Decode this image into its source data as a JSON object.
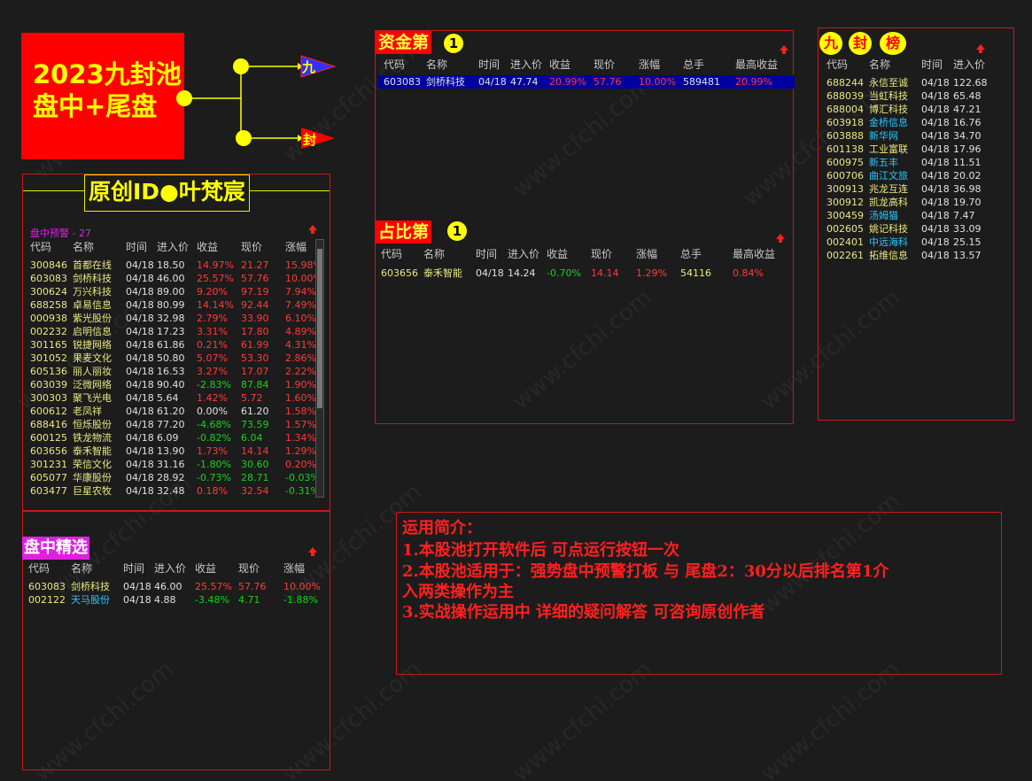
{
  "logo": {
    "line1": "2023九封池",
    "line2": "盘中+尾盘"
  },
  "flow": {
    "node_top": "九",
    "node_bottom": "封"
  },
  "author": {
    "label": "原创ID●叶梵宸"
  },
  "warning": {
    "title": "盘中预警 - 27",
    "headers": [
      "代码",
      "名称",
      "时间",
      "进入价",
      "收益",
      "现价",
      "涨幅"
    ],
    "rows": [
      [
        "300846",
        "首都在线",
        "04/18",
        "18.50",
        "14.97%",
        "21.27",
        "15.98%"
      ],
      [
        "603083",
        "剑桥科技",
        "04/18",
        "46.00",
        "25.57%",
        "57.76",
        "10.00%"
      ],
      [
        "300624",
        "万兴科技",
        "04/18",
        "89.00",
        "9.20%",
        "97.19",
        "7.94%"
      ],
      [
        "688258",
        "卓易信息",
        "04/18",
        "80.99",
        "14.14%",
        "92.44",
        "7.49%"
      ],
      [
        "000938",
        "紫光股份",
        "04/18",
        "32.98",
        "2.79%",
        "33.90",
        "6.10%"
      ],
      [
        "002232",
        "启明信息",
        "04/18",
        "17.23",
        "3.31%",
        "17.80",
        "4.89%"
      ],
      [
        "301165",
        "锐捷网络",
        "04/18",
        "61.86",
        "0.21%",
        "61.99",
        "4.31%"
      ],
      [
        "301052",
        "果麦文化",
        "04/18",
        "50.80",
        "5.07%",
        "53.30",
        "2.86%"
      ],
      [
        "605136",
        "丽人丽妆",
        "04/18",
        "16.53",
        "3.27%",
        "17.07",
        "2.22%"
      ],
      [
        "603039",
        "泛微网络",
        "04/18",
        "90.40",
        "-2.83%",
        "87.84",
        "1.90%"
      ],
      [
        "300303",
        "聚飞光电",
        "04/18",
        "5.64",
        "1.42%",
        "5.72",
        "1.60%"
      ],
      [
        "600612",
        "老凤祥",
        "04/18",
        "61.20",
        "0.00%",
        "61.20",
        "1.58%"
      ],
      [
        "688416",
        "恒烁股份",
        "04/18",
        "77.20",
        "-4.68%",
        "73.59",
        "1.57%"
      ],
      [
        "600125",
        "铁龙物流",
        "04/18",
        "6.09",
        "-0.82%",
        "6.04",
        "1.34%"
      ],
      [
        "603656",
        "泰禾智能",
        "04/18",
        "13.90",
        "1.73%",
        "14.14",
        "1.29%"
      ],
      [
        "301231",
        "荣信文化",
        "04/18",
        "31.16",
        "-1.80%",
        "30.60",
        "0.20%"
      ],
      [
        "605077",
        "华康股份",
        "04/18",
        "28.92",
        "-0.73%",
        "28.71",
        "-0.03%"
      ],
      [
        "603477",
        "巨星农牧",
        "04/18",
        "32.48",
        "0.18%",
        "32.54",
        "-0.31%"
      ]
    ]
  },
  "intraday": {
    "title": "盘中精选",
    "headers": [
      "代码",
      "名称",
      "时间",
      "进入价",
      "收益",
      "现价",
      "涨幅"
    ],
    "rows": [
      [
        "603083",
        "剑桥科技",
        "04/18",
        "46.00",
        "25.57%",
        "57.76",
        "10.00%"
      ],
      [
        "002122",
        "天马股份",
        "04/18",
        "4.88",
        "-3.48%",
        "4.71",
        "-1.88%"
      ]
    ]
  },
  "fund": {
    "title": "资金第",
    "badge": "1",
    "headers": [
      "代码",
      "名称",
      "时间",
      "进入价",
      "收益",
      "现价",
      "涨幅",
      "总手",
      "最高收益"
    ],
    "rows": [
      [
        "603083",
        "剑桥科技",
        "04/18",
        "47.74",
        "20.99%",
        "57.76",
        "10.00%",
        "589481",
        "20.99%"
      ]
    ]
  },
  "ratio": {
    "title": "占比第",
    "badge": "1",
    "headers": [
      "代码",
      "名称",
      "时间",
      "进入价",
      "收益",
      "现价",
      "涨幅",
      "总手",
      "最高收益"
    ],
    "rows": [
      [
        "603656",
        "泰禾智能",
        "04/18",
        "14.24",
        "-0.70%",
        "14.14",
        "1.29%",
        "54116",
        "0.84%"
      ]
    ]
  },
  "board": {
    "title_chars": [
      "九",
      "封",
      "榜"
    ],
    "headers": [
      "代码",
      "名称",
      "时间",
      "进入价"
    ],
    "rows": [
      [
        "688244",
        "永信至诚",
        "04/18",
        "122.68"
      ],
      [
        "688039",
        "当虹科技",
        "04/18",
        "65.48"
      ],
      [
        "688004",
        "博汇科技",
        "04/18",
        "47.21"
      ],
      [
        "603918",
        "金桥信息",
        "04/18",
        "16.76"
      ],
      [
        "603888",
        "新华网",
        "04/18",
        "34.70"
      ],
      [
        "601138",
        "工业富联",
        "04/18",
        "17.96"
      ],
      [
        "600975",
        "新五丰",
        "04/18",
        "11.51"
      ],
      [
        "600706",
        "曲江文旅",
        "04/18",
        "20.02"
      ],
      [
        "300913",
        "兆龙互连",
        "04/18",
        "36.98"
      ],
      [
        "300912",
        "凯龙高科",
        "04/18",
        "19.70"
      ],
      [
        "300459",
        "汤姆猫",
        "04/18",
        "7.47"
      ],
      [
        "002605",
        "姚记科技",
        "04/18",
        "33.09"
      ],
      [
        "002401",
        "中远海科",
        "04/18",
        "25.15"
      ],
      [
        "002261",
        "拓维信息",
        "04/18",
        "13.57"
      ]
    ]
  },
  "guide": {
    "heading": "运用简介：",
    "line1": "1.本股池打开软件后 可点运行按钮一次",
    "line2": "2.本股池适用于：强势盘中预警打板 与 尾盘2：30分以后排名第1介",
    "line3": "入两类操作为主",
    "line4": "3.实战操作运用中 详细的疑问解答 可咨询原创作者"
  },
  "colors": {
    "accent_red": "#ff0000",
    "title_yellow": "#ffff00",
    "row_highlight": "#0000a0"
  }
}
